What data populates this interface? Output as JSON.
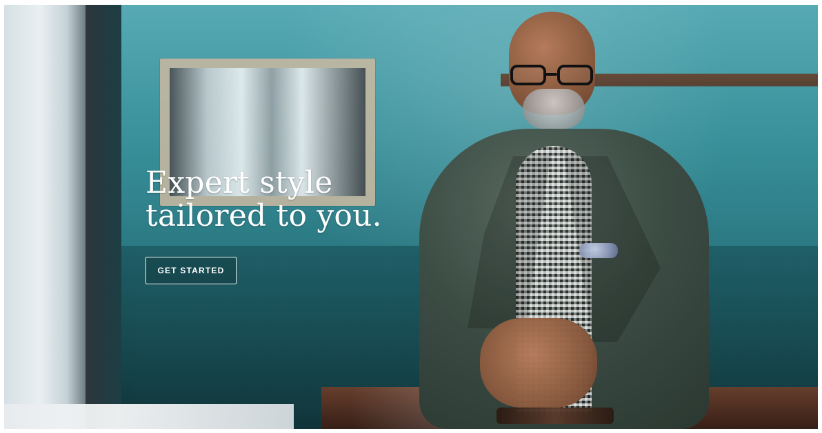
{
  "hero": {
    "headline_line1": "Expert style",
    "headline_line2": "tailored to you.",
    "cta_label": "GET STARTED"
  }
}
